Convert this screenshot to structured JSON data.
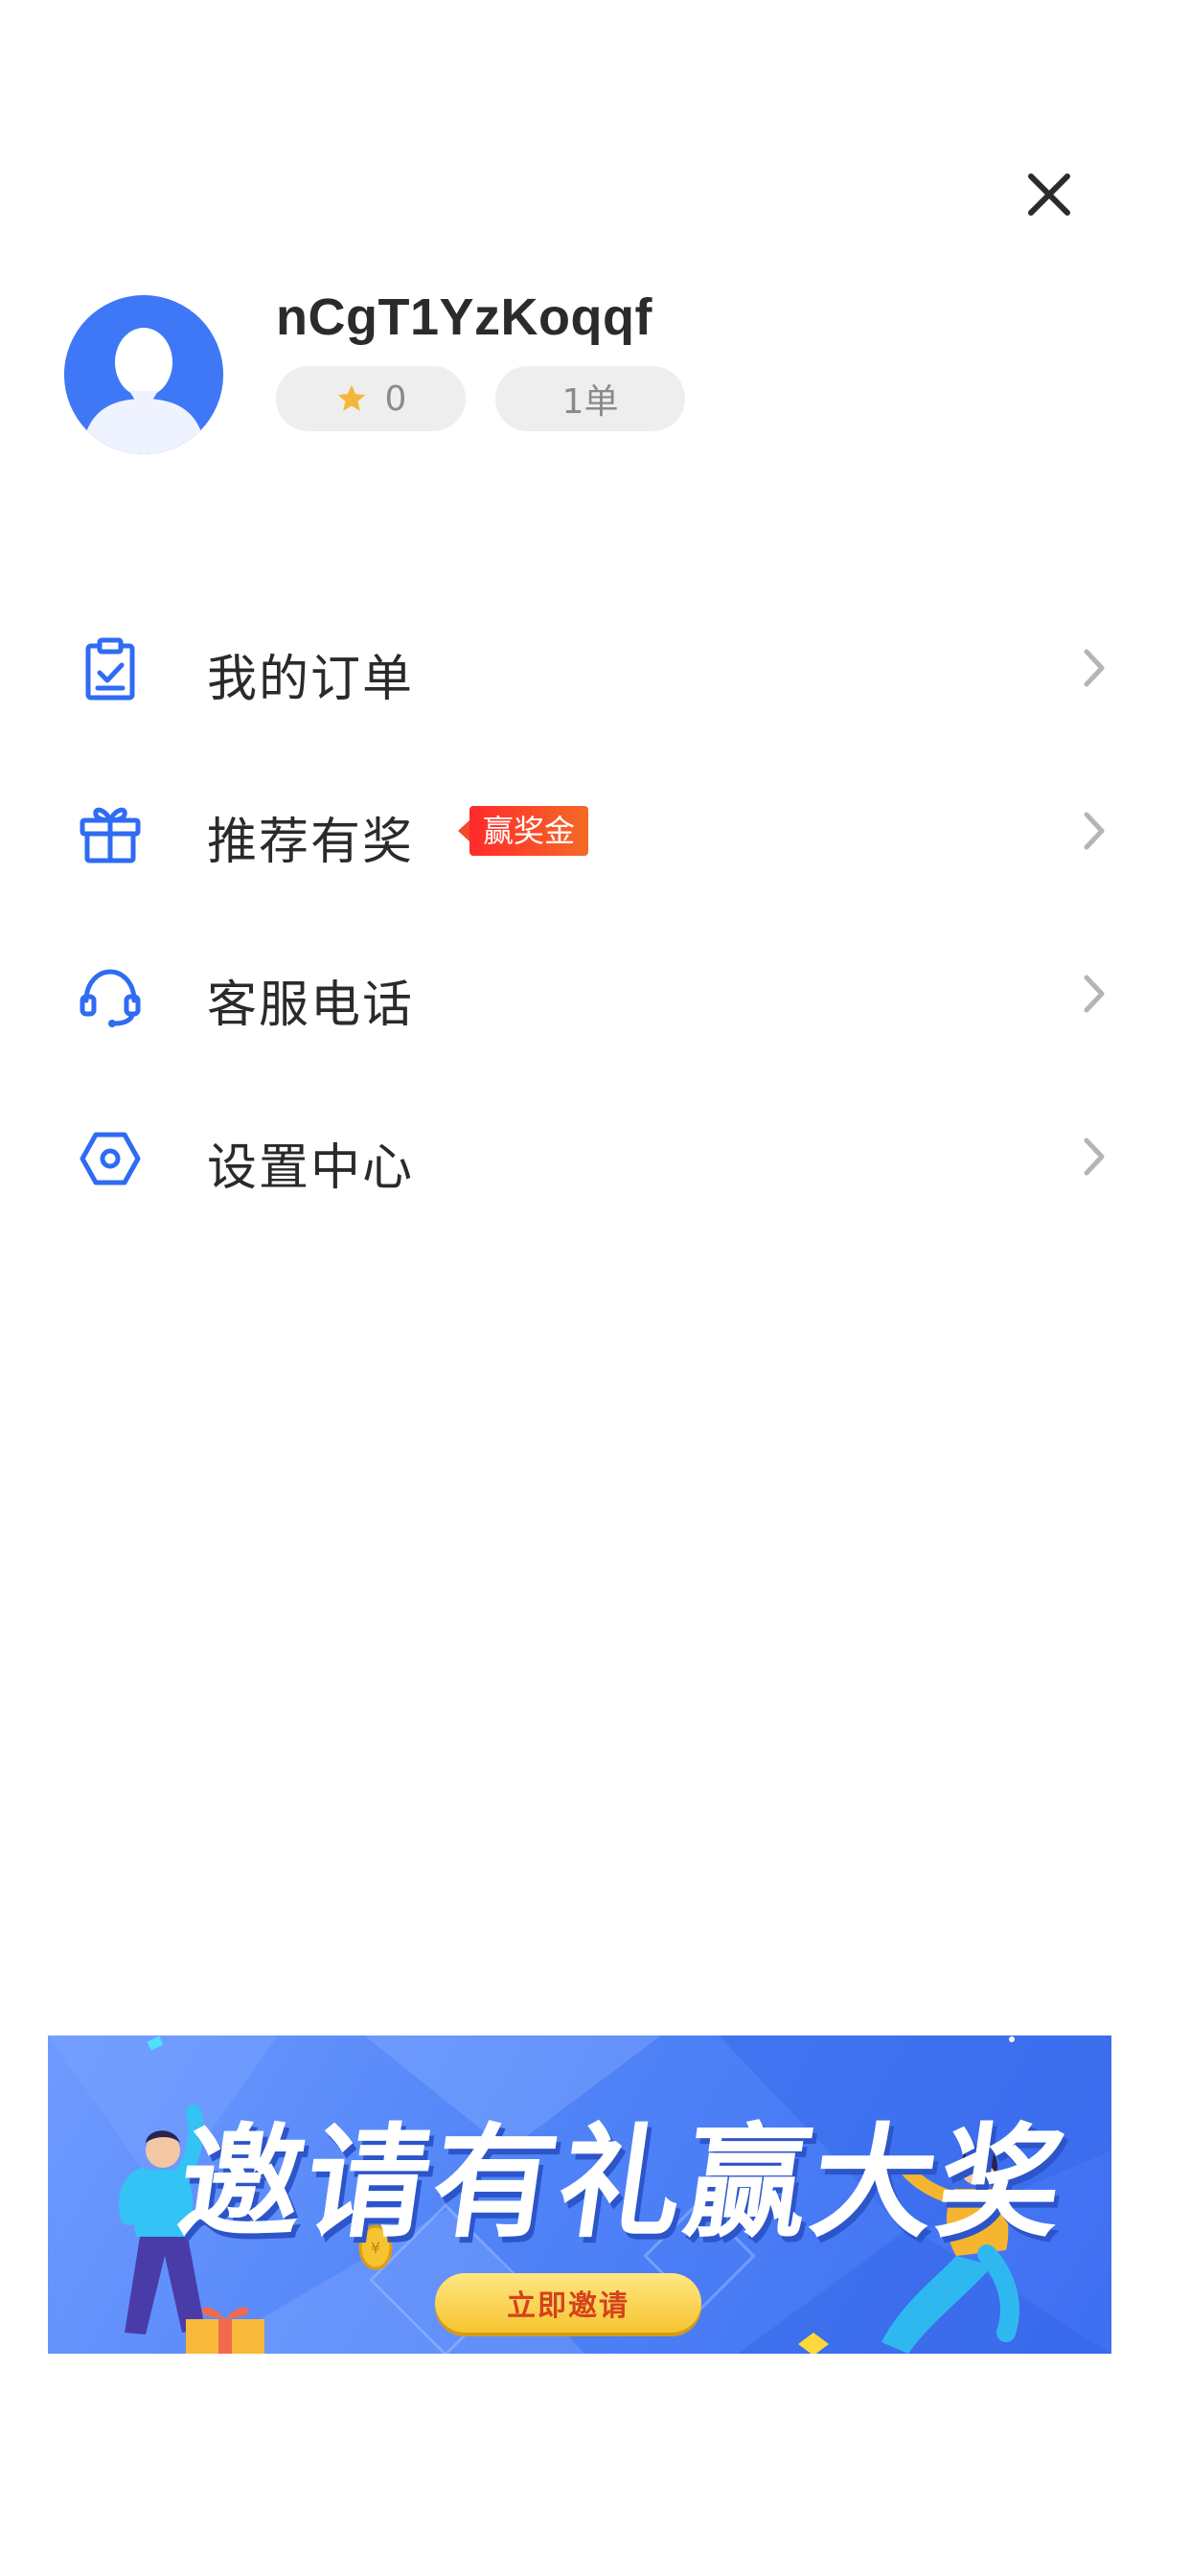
{
  "profile": {
    "username": "nCgT1YzKoqqf",
    "rating": "0",
    "orders": "1单"
  },
  "menu": {
    "items": [
      {
        "label": "我的订单",
        "icon": "order-icon"
      },
      {
        "label": "推荐有奖",
        "icon": "gift-icon",
        "badge": "赢奖金"
      },
      {
        "label": "客服电话",
        "icon": "headset-icon"
      },
      {
        "label": "设置中心",
        "icon": "settings-icon"
      }
    ]
  },
  "banner": {
    "headline": "邀请有礼赢大奖",
    "cta": "立即邀请"
  },
  "colors": {
    "accent": "#2f6bf3",
    "badge": "#f3321f",
    "star": "#f5b73b"
  }
}
